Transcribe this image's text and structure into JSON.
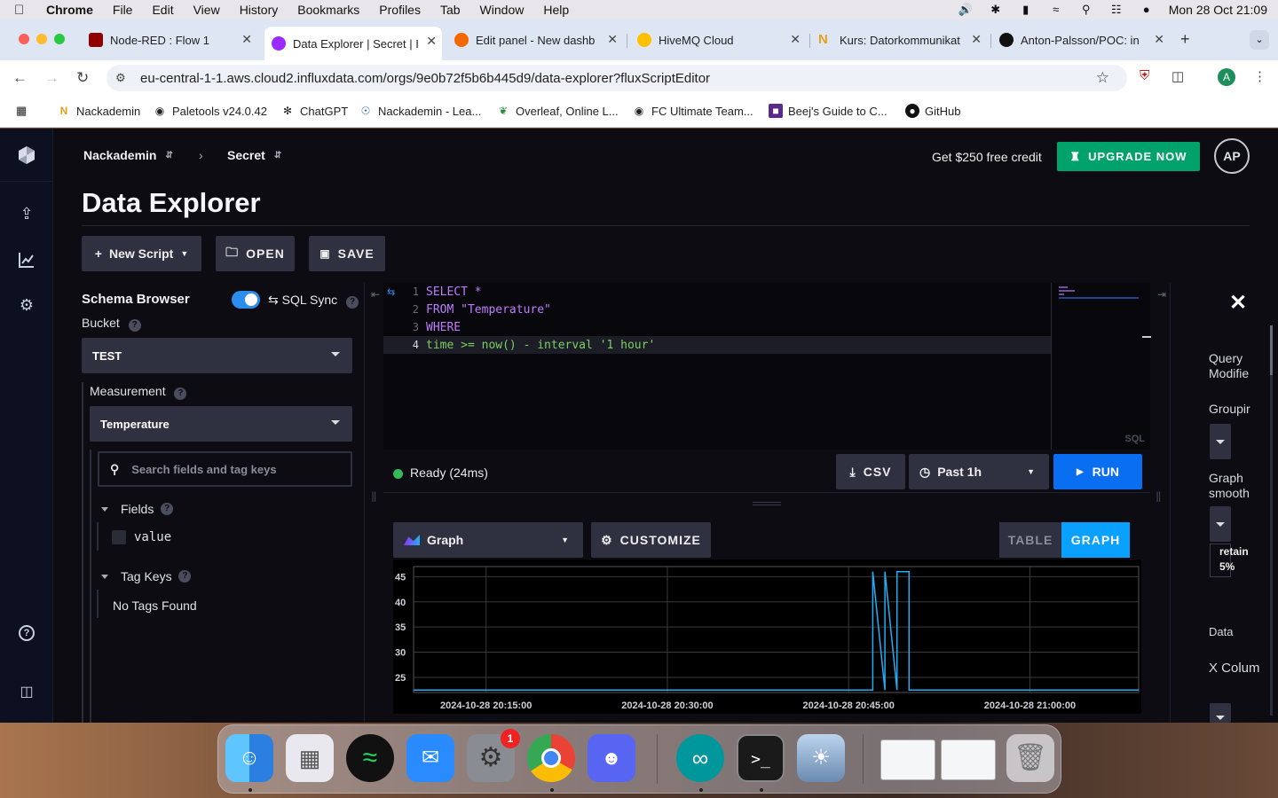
{
  "menubar": {
    "app": "Chrome",
    "items": [
      "File",
      "Edit",
      "View",
      "History",
      "Bookmarks",
      "Profiles",
      "Tab",
      "Window",
      "Help"
    ],
    "datetime": "Mon 28 Oct  21:09"
  },
  "tabs": [
    {
      "title": "Node-RED : Flow 1",
      "icon": "node-red-icon",
      "color": "#8f0000"
    },
    {
      "title": "Data Explorer | Secret | I",
      "icon": "influx-icon",
      "color": "#9b2aff"
    },
    {
      "title": "Edit panel - New dashb",
      "icon": "grafana-icon",
      "color": "#f46800"
    },
    {
      "title": "HiveMQ Cloud",
      "icon": "hivemq-icon",
      "color": "#ffc000"
    },
    {
      "title": "Kurs: Datorkommunikat",
      "icon": "nackademin-icon",
      "color": "#e8a21a"
    },
    {
      "title": "Anton-Palsson/POC: in",
      "icon": "github-icon",
      "color": "#111111"
    }
  ],
  "url": "eu-central-1-1.aws.cloud2.influxdata.com/orgs/9e0b72f5b6b445d9/data-explorer?fluxScriptEditor",
  "profile_initial": "A",
  "bookmarks": [
    "Nackademin",
    "Paletools v24.0.42",
    "ChatGPT",
    "Nackademin - Lea...",
    "Overleaf, Online L...",
    "FC Ultimate Team...",
    "Beej's Guide to C...",
    "GitHub"
  ],
  "header": {
    "org": "Nackademin",
    "bucket": "Secret",
    "credit": "Get $250 free credit",
    "upgrade": "UPGRADE NOW",
    "user_initials": "AP"
  },
  "page_title": "Data Explorer",
  "actions": {
    "new_script": "New Script",
    "open": "OPEN",
    "save": "SAVE"
  },
  "schema": {
    "title": "Schema Browser",
    "sql_sync": "SQL Sync",
    "sql_sync_enabled": true,
    "bucket_label": "Bucket",
    "bucket_value": "TEST",
    "measurement_label": "Measurement",
    "measurement_value": "Temperature",
    "search_placeholder": "Search fields and tag keys",
    "fields_label": "Fields",
    "field_value": "value",
    "tag_keys_label": "Tag Keys",
    "no_tags": "No Tags Found"
  },
  "editor": {
    "language": "SQL",
    "lines": [
      {
        "n": "1",
        "text": "SELECT *"
      },
      {
        "n": "2",
        "text": "FROM \"Temperature\""
      },
      {
        "n": "3",
        "text": "WHERE"
      },
      {
        "n": "4",
        "text": "time >= now() - interval '1 hour'"
      }
    ]
  },
  "status": {
    "text": "Ready (24ms)",
    "csv": "CSV",
    "range": "Past 1h",
    "run": "RUN"
  },
  "viz": {
    "type": "Graph",
    "customize": "CUSTOMIZE",
    "table": "TABLE",
    "graph": "GRAPH"
  },
  "chart_data": {
    "type": "line",
    "y_ticks": [
      "45",
      "40",
      "35",
      "30",
      "25"
    ],
    "x_ticks": [
      "2024-10-28 20:15:00",
      "2024-10-28 20:30:00",
      "2024-10-28 20:45:00",
      "2024-10-28 21:00:00"
    ],
    "ylim": [
      22,
      47
    ],
    "series": [
      {
        "color": "#22adf6",
        "x": [
          "20:09",
          "20:46",
          "20:47",
          "20:47",
          "20:48",
          "20:48",
          "20:49",
          "20:49",
          "20:50",
          "20:50",
          "21:00",
          "21:09"
        ],
        "y": [
          22.5,
          22.5,
          22.5,
          46,
          22.5,
          46,
          22.5,
          46,
          46,
          22.5,
          22.5,
          22.5
        ]
      }
    ]
  },
  "right_panel": {
    "query_modifiers": "Query Modifie",
    "grouping": "Groupir",
    "graph_smoothing": "Graph smooth",
    "retain": "retain",
    "retain_value": "5%",
    "data": "Data",
    "x_column": "X Colum"
  },
  "dock": [
    "finder-icon",
    "launchpad-icon",
    "spotify-icon",
    "mail-icon",
    "system-settings-icon",
    "chrome-icon",
    "discord-icon",
    "arduino-icon",
    "terminal-icon",
    "preview-icon",
    "window-thumbnail-1",
    "window-thumbnail-2",
    "trash-icon"
  ],
  "dock_badge": "1"
}
